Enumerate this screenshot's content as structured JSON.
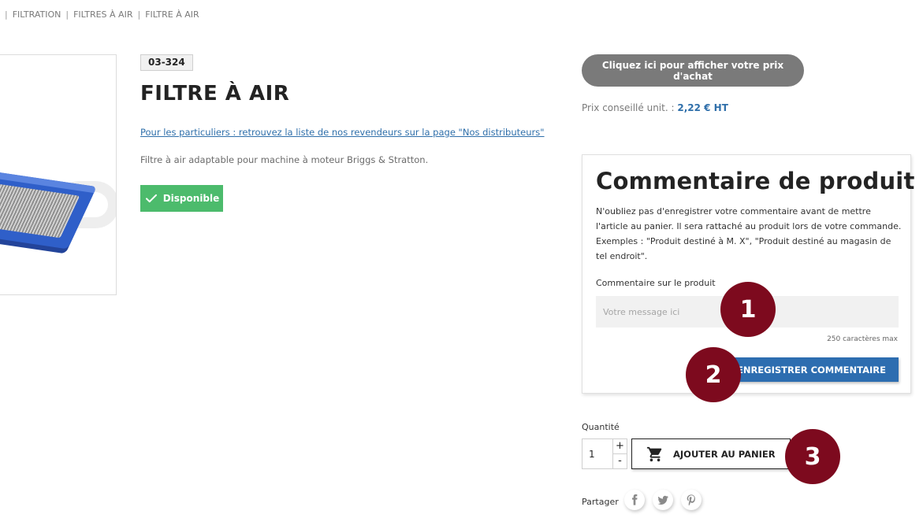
{
  "breadcrumb": {
    "items": [
      "FILTRATION",
      "FILTRES À AIR",
      "FILTRE À AIR"
    ],
    "separator": "|"
  },
  "product": {
    "reference": "03-324",
    "title": "FILTRE À AIR",
    "resellers_text": "Pour les particuliers : retrouvez la liste de nos revendeurs sur la page \"Nos distributeurs\"",
    "description": "Filtre à air adaptable pour machine à moteur Briggs & Stratton.",
    "availability": "Disponible"
  },
  "pricing": {
    "show_price_button": "Cliquez ici pour afficher votre prix d'achat",
    "advised_label": "Prix conseillé unit. :",
    "advised_value": "2,22 € HT"
  },
  "comment_panel": {
    "title": "Commentaire de produit",
    "help_text": "N'oubliez pas d'enregistrer votre commentaire avant de mettre l'article au panier. Il sera rattaché au produit lors de votre commande. Exemples : \"Produit destiné à M. X\", \"Produit destiné au magasin de tel endroit\".",
    "field_label": "Commentaire sur le produit",
    "placeholder": "Votre message ici",
    "counter": "250 caractères max",
    "save_button": "ENREGISTRER COMMENTAIRE"
  },
  "cart": {
    "quantity_label": "Quantité",
    "quantity_value": "1",
    "plus": "+",
    "minus": "-",
    "add_button": "AJOUTER AU PANIER"
  },
  "share": {
    "label": "Partager",
    "networks": [
      "facebook-icon",
      "twitter-icon",
      "pinterest-icon"
    ]
  },
  "markers": [
    "1",
    "2",
    "3"
  ],
  "colors": {
    "link_blue": "#2f6faa",
    "available_green": "#4cbb6c",
    "primary_button": "#2d6db0",
    "price_button_gray": "#7a7a7a",
    "marker_red": "#7d0a1e"
  }
}
